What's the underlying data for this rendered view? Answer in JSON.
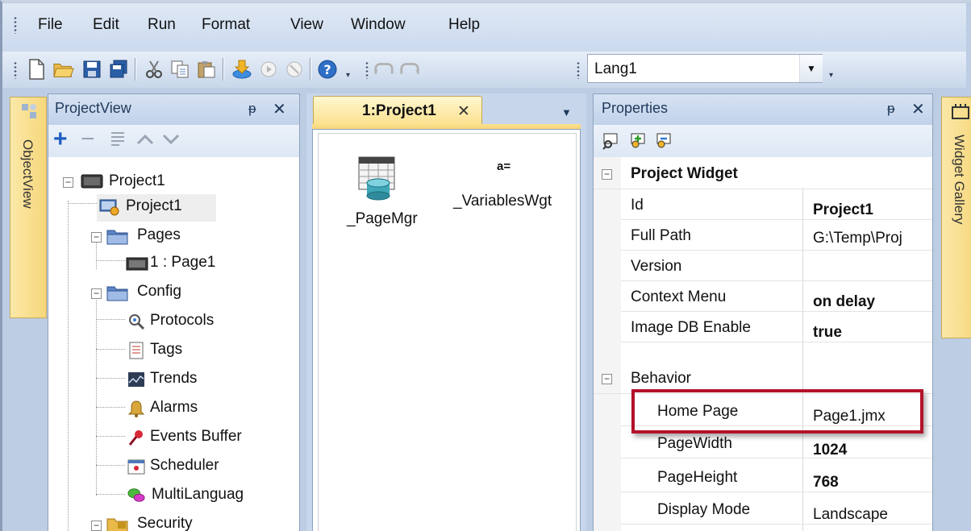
{
  "menu": {
    "items": [
      "File",
      "Edit",
      "Run",
      "Format",
      "View",
      "Window",
      "Help"
    ]
  },
  "toolbar": {
    "buttons": [
      "new-file-icon",
      "open-folder-icon",
      "save-icon",
      "save-all-icon",
      "cut-icon",
      "copy-icon",
      "paste-icon",
      "download-icon",
      "run-icon",
      "stop-icon",
      "help-icon",
      "undo-icon",
      "redo-icon"
    ],
    "language_value": "Lang1"
  },
  "left_vtab": {
    "label": "ObjectView"
  },
  "right_vtab": {
    "label": "Widget Gallery"
  },
  "project_view": {
    "title": "ProjectView",
    "tree": [
      {
        "label": "Project1",
        "icon": "monitor-icon"
      },
      {
        "label": "Project1",
        "icon": "project-settings-icon"
      },
      {
        "label": "Pages",
        "icon": "folder-icon"
      },
      {
        "label": "1 : Page1",
        "icon": "page-icon"
      },
      {
        "label": "Config",
        "icon": "folder-icon"
      },
      {
        "label": "Protocols",
        "icon": "protocols-icon"
      },
      {
        "label": "Tags",
        "icon": "tags-icon"
      },
      {
        "label": "Trends",
        "icon": "trends-icon"
      },
      {
        "label": "Alarms",
        "icon": "alarms-icon"
      },
      {
        "label": "Events Buffer",
        "icon": "events-buffer-icon"
      },
      {
        "label": "Scheduler",
        "icon": "scheduler-icon"
      },
      {
        "label": "MultiLanguag",
        "icon": "multilanguage-icon"
      },
      {
        "label": "Security",
        "icon": "security-icon"
      }
    ]
  },
  "document": {
    "tab_label": "1:Project1",
    "widgets": [
      {
        "label": "_PageMgr",
        "icon": "page-manager-icon"
      },
      {
        "label": "_VariablesWgt",
        "icon_text": "a="
      }
    ]
  },
  "properties": {
    "title": "Properties",
    "rows": [
      {
        "name": "Project Widget",
        "value": "",
        "group": true
      },
      {
        "name": "Id",
        "value": "Project1"
      },
      {
        "name": "Full Path",
        "value": "G:\\Temp\\Proj"
      },
      {
        "name": "Version",
        "value": ""
      },
      {
        "name": "Context Menu",
        "value": "on delay"
      },
      {
        "name": "Image DB Enable",
        "value": "true"
      },
      {
        "name": "Behavior",
        "value": "",
        "group": true
      },
      {
        "name": "Home Page",
        "value": "Page1.jmx",
        "highlighted": true
      },
      {
        "name": "PageWidth",
        "value": "1024"
      },
      {
        "name": "PageHeight",
        "value": "768"
      },
      {
        "name": "Display Mode",
        "value": "Landscape"
      }
    ],
    "highlight_color": "#b3122a"
  }
}
